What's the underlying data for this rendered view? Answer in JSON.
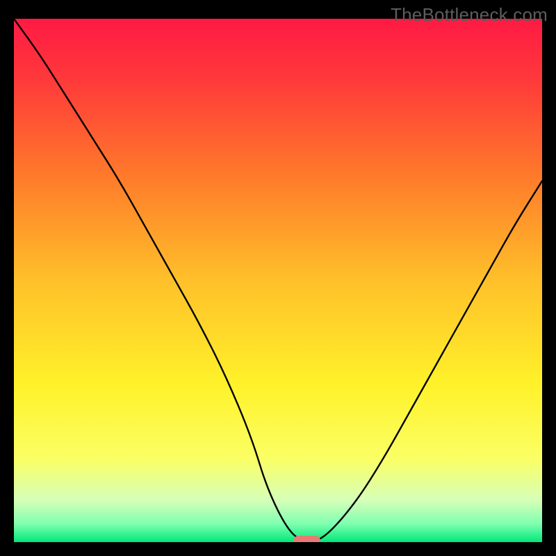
{
  "watermark": "TheBottleneck.com",
  "chart_data": {
    "type": "line",
    "title": "",
    "xlabel": "",
    "ylabel": "",
    "x_range": [
      0,
      100
    ],
    "y_range": [
      0,
      100
    ],
    "series": [
      {
        "name": "bottleneck-curve",
        "x": [
          0,
          5,
          10,
          15,
          20,
          25,
          30,
          35,
          40,
          45,
          48,
          52,
          55,
          57,
          60,
          65,
          70,
          75,
          80,
          85,
          90,
          95,
          100
        ],
        "y": [
          100,
          93,
          85,
          77,
          69,
          60,
          51,
          42,
          32,
          20,
          10,
          2,
          0,
          0,
          2,
          8,
          16,
          25,
          34,
          43,
          52,
          61,
          69
        ]
      }
    ],
    "marker": {
      "x_start": 53,
      "x_end": 58,
      "y": 0
    },
    "gradient_stops": [
      {
        "offset": 0.0,
        "color": "#ff1a44"
      },
      {
        "offset": 0.12,
        "color": "#ff3a3a"
      },
      {
        "offset": 0.3,
        "color": "#ff7a2a"
      },
      {
        "offset": 0.5,
        "color": "#ffc02a"
      },
      {
        "offset": 0.7,
        "color": "#fff22a"
      },
      {
        "offset": 0.84,
        "color": "#fbff64"
      },
      {
        "offset": 0.92,
        "color": "#d6ffb8"
      },
      {
        "offset": 0.965,
        "color": "#7fffb0"
      },
      {
        "offset": 1.0,
        "color": "#00e878"
      }
    ],
    "curve_color": "#000000",
    "marker_color": "#e77a74"
  }
}
